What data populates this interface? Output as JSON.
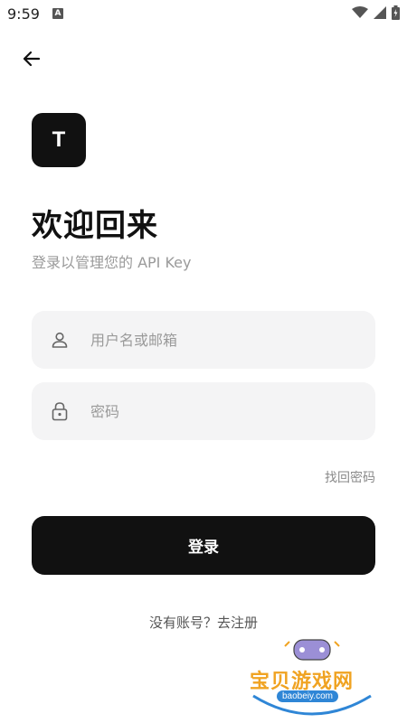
{
  "status_bar": {
    "time": "9:59",
    "notification_letter": "A"
  },
  "header": {
    "back_icon": "arrow-left-icon"
  },
  "logo": {
    "letter": "T"
  },
  "title": "欢迎回来",
  "subtitle": "登录以管理您的 API Key",
  "form": {
    "username": {
      "placeholder": "用户名或邮箱",
      "value": "",
      "icon": "user-icon"
    },
    "password": {
      "placeholder": "密码",
      "value": "",
      "icon": "lock-icon"
    },
    "forgot_label": "找回密码",
    "login_label": "登录"
  },
  "signup": {
    "prompt": "没有账号？",
    "link": "去注册"
  },
  "watermark": {
    "text": "宝贝游戏网",
    "url": "baobeiy.com"
  },
  "colors": {
    "primary": "#111111",
    "field_bg": "#f4f4f5",
    "muted_text": "#9a9a9a"
  }
}
